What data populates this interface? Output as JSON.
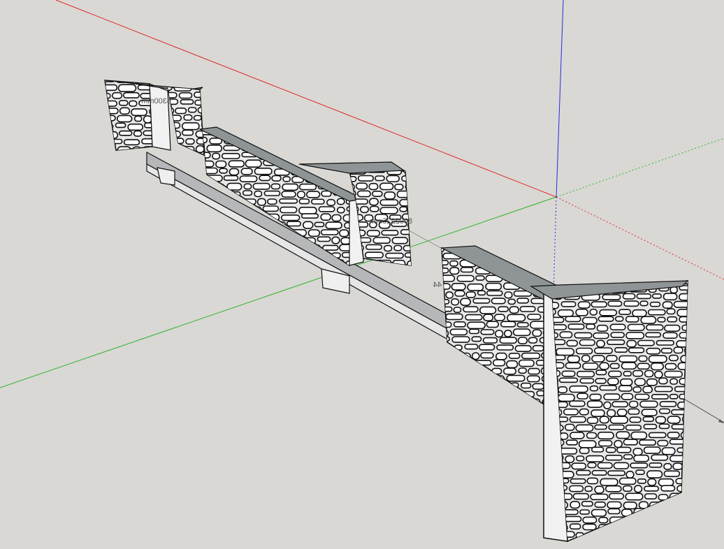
{
  "scene": {
    "background_color": "#d9d8d4",
    "axis_colors": {
      "red": "#e12a2a",
      "green": "#2db32d",
      "blue": "#2a2ae1"
    },
    "wall": {
      "stone_fill": "#ffffff",
      "stone_outline": "#111111",
      "cap_top": "#8f9496",
      "cap_side": "#c9cacb",
      "inner_face": "#f2f2f2"
    },
    "dimension_labels": {
      "left": "6300mm",
      "center": "8002225mm",
      "right": "44"
    }
  }
}
